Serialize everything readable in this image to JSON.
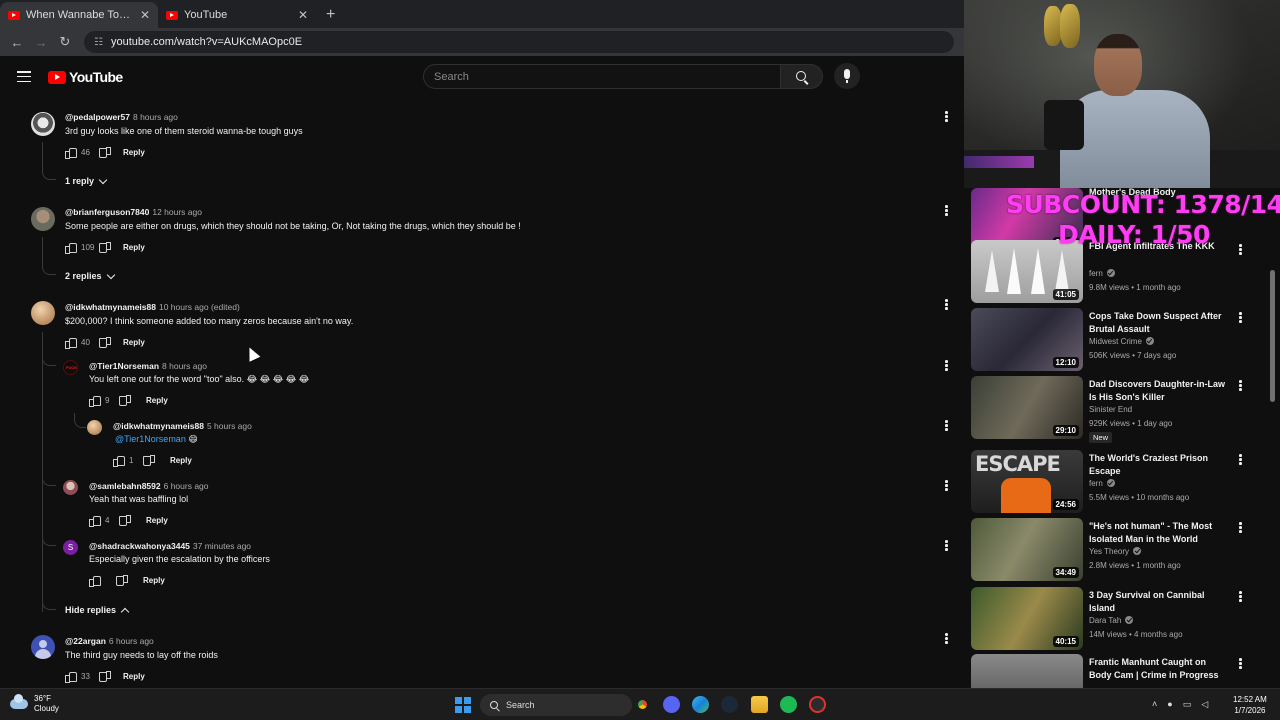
{
  "browser": {
    "tabs": [
      {
        "title": "When Wannabe Tough Guys Pu",
        "active": true
      },
      {
        "title": "YouTube",
        "active": false
      }
    ],
    "new_tab": "+",
    "url": "youtube.com/watch?v=AUKcMAOpc0E"
  },
  "yt": {
    "logo_text": "YouTube",
    "search_placeholder": "Search"
  },
  "comments": [
    {
      "handle": "@pedalpower57",
      "time": "8 hours ago",
      "text": "3rd guy looks like one of them steroid wanna-be tough guys",
      "likes": "46",
      "reply": "Reply",
      "toggle": "1 reply"
    },
    {
      "handle": "@brianferguson7840",
      "time": "12 hours ago",
      "text": "Some people are either on drugs, which they should not be taking, Or, Not taking the drugs, which they should be !",
      "likes": "109",
      "reply": "Reply",
      "toggle": "2 replies"
    },
    {
      "handle": "@idkwhatmynameis88",
      "time": "10 hours ago (edited)",
      "text": "$200,000? I think someone added too many zeros because ain't no way.",
      "likes": "40",
      "reply": "Reply"
    },
    {
      "handle": "@22argan",
      "time": "6 hours ago",
      "text": "The third guy needs to lay off the roids",
      "likes": "33",
      "reply": "Reply"
    }
  ],
  "replies": [
    {
      "handle": "@Tier1Norseman",
      "time": "8 hours ago",
      "text": "You left one out for the word \"too\" also. 😂 😂 😂 😂 😂",
      "likes": "9",
      "reply": "Reply"
    },
    {
      "handle": "@idkwhatmynameis88",
      "time": "5 hours ago",
      "mention": "@Tier1Norseman",
      "text": " 😄",
      "likes": "1",
      "reply": "Reply"
    },
    {
      "handle": "@samlebahn8592",
      "time": "6 hours ago",
      "text": "Yeah that was baffling lol",
      "likes": "4",
      "reply": "Reply"
    },
    {
      "handle": "@shadrackwahonya3445",
      "time": "37 minutes ago",
      "avatar_letter": "S",
      "text": "Especially given the escalation by the officers",
      "likes": "",
      "reply": "Reply"
    }
  ],
  "hide_replies": "Hide replies",
  "overlay": {
    "sub_count": "SUBCOUNT: 1378/1400",
    "daily": "DAILY: 1/50"
  },
  "recommendations": [
    {
      "title": "Mother's Dead Body",
      "channel": "",
      "meta": "",
      "duration": "36:18",
      "verified": false
    },
    {
      "title": "FBI Agent Infiltrates The KKK",
      "channel": "fern",
      "meta": "9.8M views • 1 month ago",
      "duration": "41:05",
      "verified": true
    },
    {
      "title": "Cops Take Down Suspect After Brutal Assault",
      "channel": "Midwest Crime",
      "meta": "506K views • 7 days ago",
      "duration": "12:10",
      "verified": true
    },
    {
      "title": "Dad Discovers Daughter-in-Law Is His Son's Killer",
      "channel": "Sinister End",
      "meta": "929K views • 1 day ago",
      "duration": "29:10",
      "verified": false,
      "badge": "New"
    },
    {
      "title": "The World's Craziest Prison Escape",
      "channel": "fern",
      "meta": "5.5M views • 10 months ago",
      "duration": "24:56",
      "verified": true,
      "thumb_text": "ESCAPE"
    },
    {
      "title": "\"He's not human\" - The Most Isolated Man in the World",
      "channel": "Yes Theory",
      "meta": "2.8M views • 1 month ago",
      "duration": "34:49",
      "verified": true
    },
    {
      "title": "3 Day Survival on Cannibal Island",
      "channel": "Dara Tah",
      "meta": "14M views • 4 months ago",
      "duration": "40:15",
      "verified": true
    },
    {
      "title": "Frantic Manhunt Caught on Body Cam | Crime in Progress ...",
      "channel": "",
      "meta": "",
      "duration": "",
      "verified": false
    }
  ],
  "taskbar": {
    "temp": "36°F",
    "condition": "Cloudy",
    "search": "Search",
    "time": "12:52 AM",
    "date": "1/7/2026"
  },
  "icons": [
    "menu-icon",
    "search-icon",
    "mic-icon",
    "thumb-up-icon",
    "thumb-down-icon",
    "kebab-icon",
    "chevron-down-icon",
    "chevron-up-icon",
    "windows-icon",
    "cloud-icon"
  ]
}
